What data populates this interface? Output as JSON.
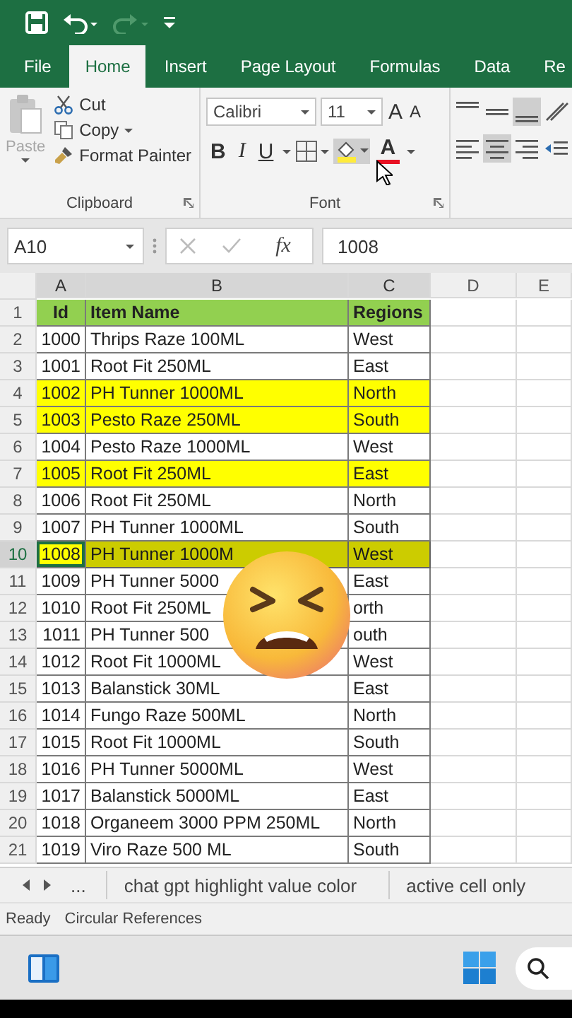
{
  "quick_access": [
    {
      "kind": "save",
      "disabled": false
    },
    {
      "kind": "undo",
      "disabled": false
    },
    {
      "kind": "redo",
      "disabled": true
    },
    {
      "kind": "customize",
      "disabled": false
    }
  ],
  "ribbon_tabs": [
    {
      "label": "File",
      "selected": false
    },
    {
      "label": "Home",
      "selected": true
    },
    {
      "label": "Insert",
      "selected": false
    },
    {
      "label": "Page Layout",
      "selected": false
    },
    {
      "label": "Formulas",
      "selected": false
    },
    {
      "label": "Data",
      "selected": false
    },
    {
      "label": "Re",
      "selected": false
    }
  ],
  "clipboard": {
    "paste": {
      "label": "Paste",
      "disabled": true
    },
    "cut": "Cut",
    "copy": "Copy",
    "format_painter": "Format Painter",
    "group_label": "Clipboard"
  },
  "font": {
    "name": "Calibri",
    "size": "11",
    "grow": "A",
    "shrink": "A",
    "bold": "B",
    "italic": "I",
    "underline": "U",
    "font_color": "A",
    "group_label": "Font"
  },
  "formula_bar": {
    "name_box": "A10",
    "fx": "fx",
    "value": "1008"
  },
  "sheet": {
    "columns": [
      {
        "label": "A",
        "selected": true
      },
      {
        "label": "B",
        "selected": true
      },
      {
        "label": "C",
        "selected": true
      },
      {
        "label": "D",
        "selected": false
      },
      {
        "label": "E",
        "selected": false
      }
    ],
    "rows": [
      {
        "number": "1",
        "kind": "header",
        "color": "#92d050",
        "selected": false,
        "cells": [
          "Id",
          "Item Name",
          "Regions"
        ]
      },
      {
        "number": "2",
        "kind": "data",
        "selected": false,
        "cells": [
          "1000",
          "Thrips Raze 100ML",
          "West"
        ]
      },
      {
        "number": "3",
        "kind": "data",
        "selected": false,
        "cells": [
          "1001",
          "Root Fit 250ML",
          "East"
        ]
      },
      {
        "number": "4",
        "kind": "data",
        "color": "#ffff00",
        "selected": false,
        "cells": [
          "1002",
          "PH Tunner 1000ML",
          "North"
        ]
      },
      {
        "number": "5",
        "kind": "data",
        "color": "#ffff00",
        "selected": false,
        "cells": [
          "1003",
          "Pesto Raze 250ML",
          "South"
        ]
      },
      {
        "number": "6",
        "kind": "data",
        "selected": false,
        "cells": [
          "1004",
          "Pesto Raze 1000ML",
          "West"
        ]
      },
      {
        "number": "7",
        "kind": "data",
        "color": "#ffff00",
        "selected": false,
        "cells": [
          "1005",
          "Root Fit 250ML",
          "East"
        ]
      },
      {
        "number": "8",
        "kind": "data",
        "selected": false,
        "cells": [
          "1006",
          "Root Fit 250ML",
          "North"
        ]
      },
      {
        "number": "9",
        "kind": "data",
        "selected": false,
        "cells": [
          "1007",
          "PH Tunner 1000ML",
          "South"
        ]
      },
      {
        "number": "10",
        "kind": "data",
        "color": "#ffff00",
        "selected": true,
        "cells": [
          "1008",
          "PH Tunner 1000M",
          "West"
        ]
      },
      {
        "number": "11",
        "kind": "data",
        "selected": false,
        "cells": [
          "1009",
          "PH Tunner 5000",
          "East"
        ]
      },
      {
        "number": "12",
        "kind": "data",
        "selected": false,
        "cells": [
          "1010",
          "Root Fit 250ML",
          "orth"
        ]
      },
      {
        "number": "13",
        "kind": "data",
        "selected": false,
        "cells": [
          "1011",
          "PH Tunner 500",
          "outh"
        ]
      },
      {
        "number": "14",
        "kind": "data",
        "selected": false,
        "cells": [
          "1012",
          "Root Fit 1000ML",
          "West"
        ]
      },
      {
        "number": "15",
        "kind": "data",
        "selected": false,
        "cells": [
          "1013",
          "Balanstick 30ML",
          "East"
        ]
      },
      {
        "number": "16",
        "kind": "data",
        "selected": false,
        "cells": [
          "1014",
          "Fungo Raze 500ML",
          "North"
        ]
      },
      {
        "number": "17",
        "kind": "data",
        "selected": false,
        "cells": [
          "1015",
          "Root Fit 1000ML",
          "South"
        ]
      },
      {
        "number": "18",
        "kind": "data",
        "selected": false,
        "cells": [
          "1016",
          "PH Tunner 5000ML",
          "West"
        ]
      },
      {
        "number": "19",
        "kind": "data",
        "selected": false,
        "cells": [
          "1017",
          "Balanstick 5000ML",
          "East"
        ]
      },
      {
        "number": "20",
        "kind": "data",
        "selected": false,
        "cells": [
          "1018",
          "Organeem 3000 PPM 250ML",
          "North"
        ]
      },
      {
        "number": "21",
        "kind": "data",
        "selected": false,
        "cells": [
          "1019",
          "Viro Raze 500 ML",
          "South"
        ]
      }
    ]
  },
  "sheet_tabs": {
    "more": "...",
    "tabs": [
      {
        "label": "chat gpt highlight value color",
        "selected": false
      },
      {
        "label": "active cell only",
        "selected": false
      }
    ]
  },
  "status_bar": {
    "items": [
      "Ready",
      "Circular References"
    ]
  }
}
